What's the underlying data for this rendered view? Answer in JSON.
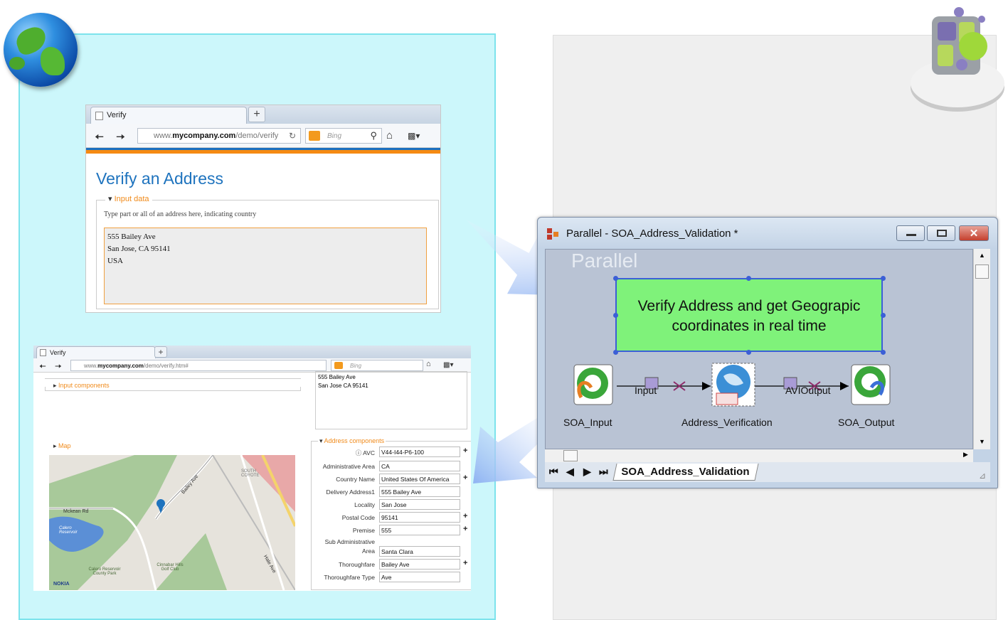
{
  "browser1": {
    "tab_title": "Verify",
    "url_prefix": "www.",
    "url_domain": "mycompany.com",
    "url_path": "/demo/verify",
    "search_placeholder": "Bing",
    "page_title": "Verify an Address",
    "legend": "Input data",
    "hint": "Type part or all of an address here, indicating country",
    "address_lines": [
      "555 Bailey Ave",
      "San Jose, CA 95141",
      "USA"
    ]
  },
  "browser2": {
    "tab_title": "Verify",
    "url_prefix": "www.",
    "url_domain": "mycompany.com",
    "url_path": "/demo/verify.htm#",
    "search_placeholder": "Bing",
    "input_components_label": "Input components",
    "map_label": "Map",
    "address_lines": [
      "555 Bailey Ave",
      "San Jose CA 95141"
    ],
    "address_components_label": "Address components",
    "components": [
      {
        "label": "AVC",
        "value": "V44-I44-P6-100",
        "plus": true
      },
      {
        "label": "Administrative Area",
        "value": "CA",
        "plus": false
      },
      {
        "label": "Country Name",
        "value": "United States Of America",
        "plus": true
      },
      {
        "label": "Delivery Address1",
        "value": "555 Bailey Ave",
        "plus": false
      },
      {
        "label": "Locality",
        "value": "San Jose",
        "plus": false
      },
      {
        "label": "Postal Code",
        "value": "95141",
        "plus": true
      },
      {
        "label": "Premise",
        "value": "555",
        "plus": true
      },
      {
        "label": "Sub Administrative Area",
        "value": "Santa Clara",
        "plus": false
      },
      {
        "label": "Thoroughfare",
        "value": "Bailey Ave",
        "plus": true
      },
      {
        "label": "Thoroughfare Type",
        "value": "Ave",
        "plus": false
      }
    ],
    "map_labels": {
      "road1": "Bailey Ave",
      "road2": "Mckean Rd",
      "road3": "Hale Ave",
      "lake": "Calero Reservoir",
      "park": "Calero Reservoir County Park",
      "golf": "Cinnabar Hills Golf Club",
      "area": "SOUTH COYOTE",
      "brand": "NOKIA"
    }
  },
  "designer": {
    "window_title": "Parallel - SOA_Address_Validation *",
    "canvas_watermark": "Parallel",
    "annotation": "Verify Address and get Geograpic coordinates in real time",
    "stages": [
      "SOA_Input",
      "Address_Verification",
      "SOA_Output"
    ],
    "links": [
      "Input",
      "AVIOutput"
    ],
    "tab": "SOA_Address_Validation"
  }
}
